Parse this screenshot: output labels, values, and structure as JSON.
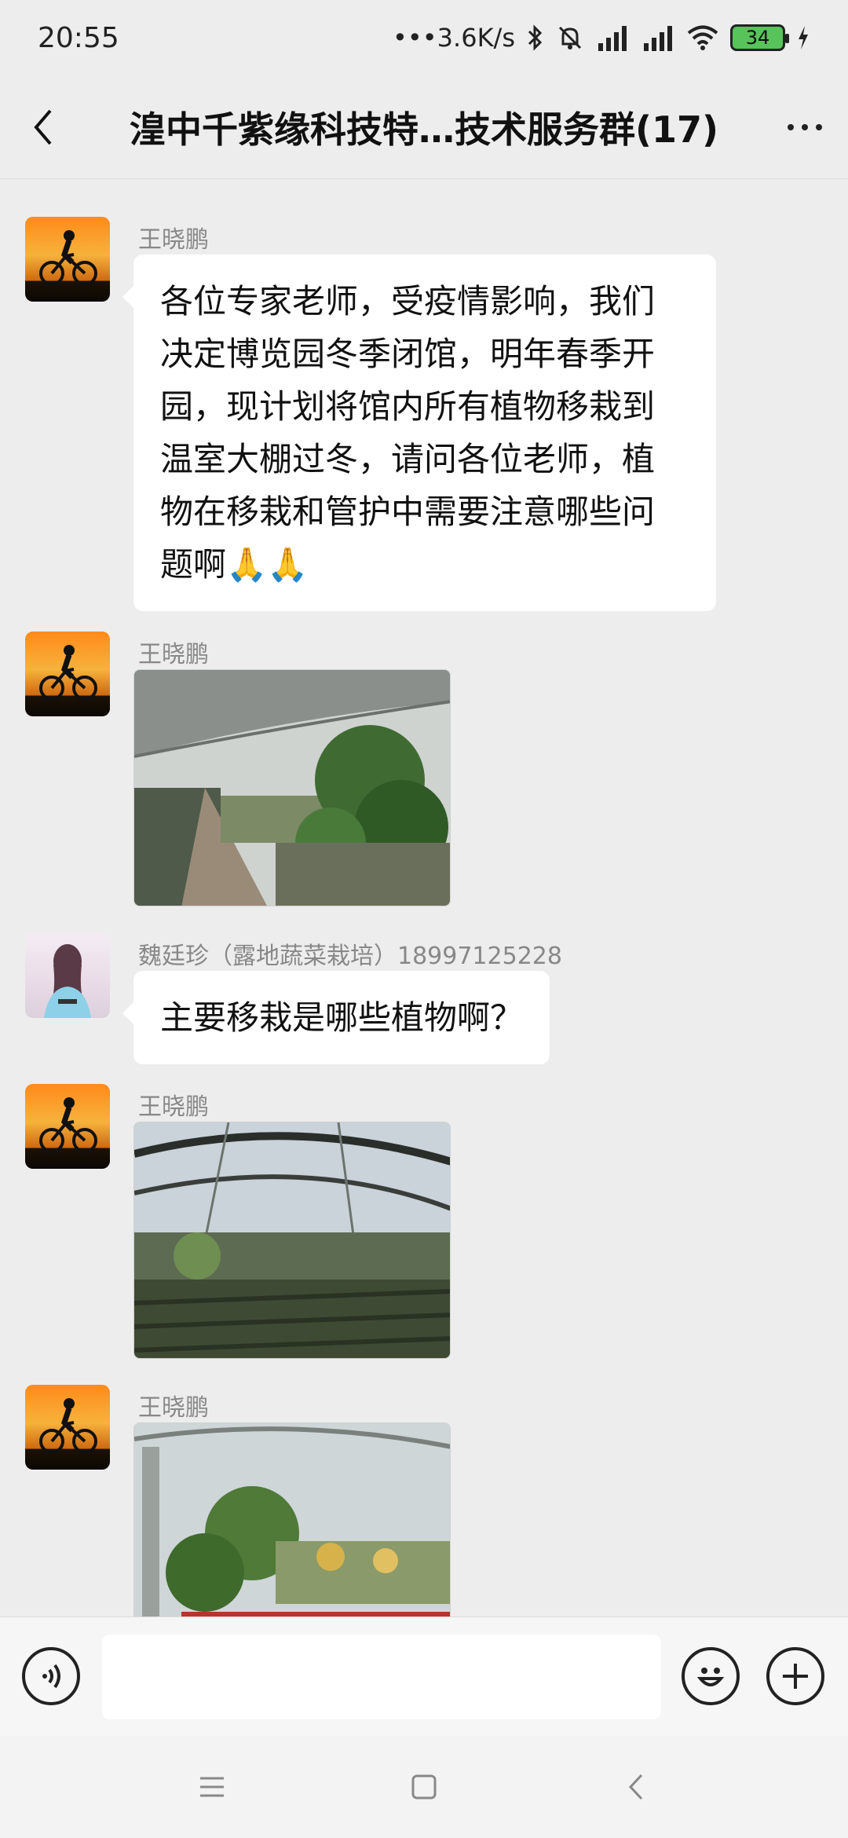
{
  "status_bar": {
    "time": "20:55",
    "speed": "•••3.6K/s",
    "battery": "34"
  },
  "header": {
    "title": "湟中千紫缘科技特…技术服务群(17)"
  },
  "messages": [
    {
      "sender": "王晓鹏",
      "type": "text",
      "lines": [
        "各位专家老师，受疫情影响，我们",
        "决定博览园冬季闭馆，明年春季开",
        "园，现计划将馆内所有植物移栽到",
        "温室大棚过冬，请问各位老师，植",
        "物在移栽和管护中需要注意哪些问",
        "题啊🙏🙏"
      ]
    },
    {
      "sender": "王晓鹏",
      "type": "image",
      "alt": "greenhouse-photo-1"
    },
    {
      "sender": "魏廷珍（露地蔬菜栽培）18997125228",
      "type": "text",
      "lines": [
        "主要移栽是哪些植物啊？"
      ]
    },
    {
      "sender": "王晓鹏",
      "type": "image",
      "alt": "greenhouse-photo-2"
    },
    {
      "sender": "王晓鹏",
      "type": "image",
      "alt": "greenhouse-photo-3"
    }
  ],
  "input_bar": {
    "value": "",
    "icons": [
      "voice-icon",
      "emoji-icon",
      "plus-icon"
    ]
  },
  "nav_bar": {
    "icons": [
      "menu-icon",
      "home-icon",
      "back-icon"
    ]
  },
  "colors": {
    "background": "#ededed",
    "bubble": "#ffffff",
    "sender_text": "#888888",
    "battery": "#58c35a"
  }
}
